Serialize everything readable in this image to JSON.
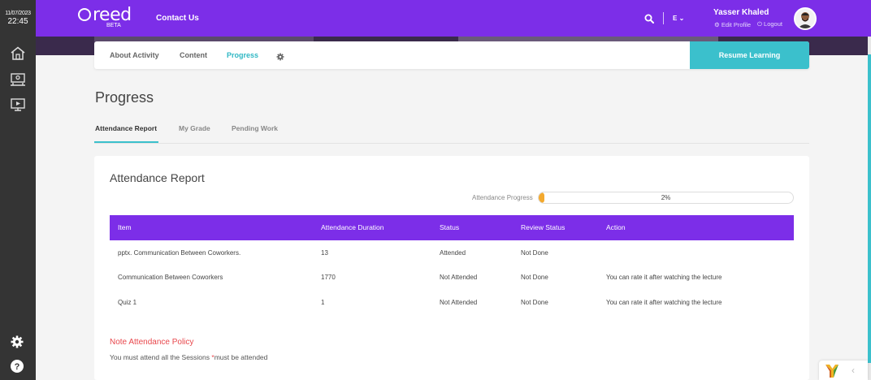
{
  "topbar": {
    "date": "11/07/2023",
    "time": "22:45",
    "logo_text": "reed",
    "logo_badge": "BETA",
    "contact_label": "Contact Us",
    "lang_label": "E",
    "user_name": "Yasser Khaled",
    "edit_profile_label": "Edit Profile",
    "logout_label": "Logout",
    "brand_color": "#7c2ee8"
  },
  "sidebar": {
    "items": [
      {
        "icon": "home-icon"
      },
      {
        "icon": "classroom-icon"
      },
      {
        "icon": "video-lecture-icon"
      }
    ],
    "bottom": [
      {
        "icon": "settings-gear-icon"
      },
      {
        "icon": "help-icon"
      }
    ]
  },
  "course_tabs": {
    "tabs": [
      "About Activity",
      "Content",
      "Progress"
    ],
    "active_tab": "Progress",
    "resume_label": "Resume Learning",
    "accent_color": "#3bc0cc"
  },
  "page": {
    "title": "Progress",
    "subtabs": [
      "Attendance Report",
      "My Grade",
      "Pending Work"
    ],
    "active_subtab": "Attendance Report"
  },
  "report": {
    "title": "Attendance Report",
    "progress_label": "Attendance Progress",
    "progress_value": 0.02,
    "progress_text": "2%",
    "columns": [
      "Item",
      "Attendance Duration",
      "Status",
      "Review Status",
      "Action"
    ],
    "rows": [
      [
        "pptx. Communication Between Coworkers.",
        "13",
        "Attended",
        "Not Done",
        ""
      ],
      [
        "Communication Between Coworkers",
        "1770",
        "Not Attended",
        "Not Done",
        "You can rate it after watching the lecture"
      ],
      [
        "Quiz 1",
        "1",
        "Not Attended",
        "Not Done",
        "You can rate it after watching the lecture"
      ]
    ],
    "note_title": "Note Attendance Policy",
    "note_text_before": "You must attend all the Sessions ",
    "note_star": "*",
    "note_text_after": "must be attended"
  }
}
